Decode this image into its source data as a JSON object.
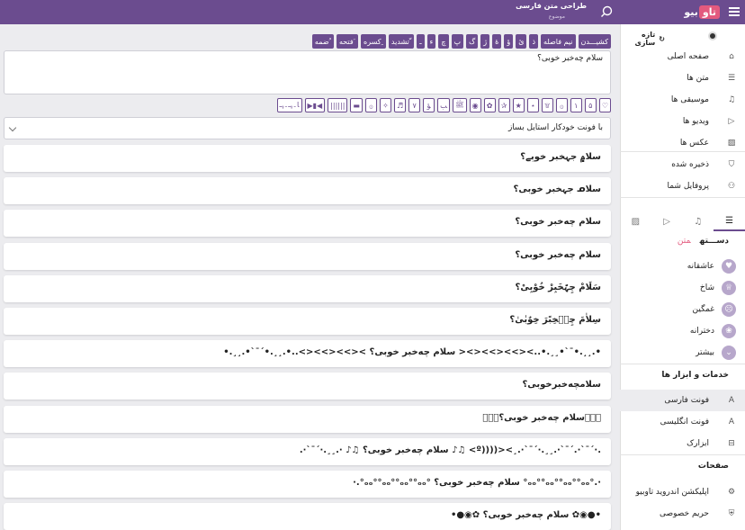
{
  "header": {
    "logo_word": "بیو",
    "logo_badge": "تاو",
    "title": "طراحی متن فارسی",
    "subtitle": "موضوع"
  },
  "keyboard": [
    "کشیـــدن",
    "نیم فاصله",
    "ذ",
    "ئ",
    "ؤ",
    "ۀ",
    "ژ",
    "ﮒ",
    "ﭖ",
    "ﭺ",
    "ء",
    "ـ",
    "تشدید ّ",
    "کسره ِ",
    "فتحه َ",
    "ضمه ُ"
  ],
  "input": {
    "value": "سلام چه‌خبر خوبی؟"
  },
  "symbols": [
    "♡",
    "۵",
    "۱",
    "۞",
    "۩",
    "⋆",
    "★",
    "✰",
    "✿",
    "◉",
    "ﷺ",
    "ﺐ",
    "ﺆ",
    "۷",
    "♬",
    "✧",
    "۞",
    "▬",
    "||||||",
    "▶▮◀",
    "ﺎ۔ﮩـ۔ﮩـ"
  ],
  "style_select": {
    "value": "با فونت خودکار استایل بساز"
  },
  "results": [
    "سلا۾ جہخبر خوٻے؟",
    "سلاᓄ جہخبر خوبی؟",
    "سلام چه‌خبر خوبی؟",
    "سلام چه‌خبر خوبی؟",
    "سَلَامْ چِہّخَبِرْ خُوْبِیْ؟",
    "سِلاٰمَ چِہؒخِبًرَ خِوٌبٰیٰ؟",
    "•.¸¸.•¯`•¸¸.•..><>><>><>< سلام چه‌خبر خوبی؟ ><>><>><>..•.¸¸.•´¯`•.¸¸.•",
    "سلامچه‌خبرخوبی؟",
    "⃟⃟⃟سلام چه‌خبر خوبی؟⃟⃟⃟",
    ".·´¯`·.´¯`·.¸¸.·´¯`·.¸><((((º> ♫♪ سلام چه‌خبر خوبی؟ ♫♪ ·.¸¸.·´¯`·.",
    "·.°ₒₒ°°ₒₒ°°ₒₒ°°ₒₒ° سلام چه‌خبر خوبی؟ °ₒₒ°°ₒₒ°°ₒₒ°°ₒₒ°.·",
    "•●◉✿ سلام چه‌خبر خوبی؟ ✿◉●•"
  ],
  "sidebar": {
    "refresh_label": "تازه سازی",
    "nav": [
      {
        "label": "صفحه اصلی",
        "icon": "home-icon",
        "glyph": "⌂"
      },
      {
        "label": "متن ها",
        "icon": "text-lines-icon",
        "glyph": "☰"
      },
      {
        "label": "موسیقی ها",
        "icon": "music-icon",
        "glyph": "♫"
      },
      {
        "label": "ویدیو ها",
        "icon": "play-icon",
        "glyph": "▷"
      },
      {
        "label": "عکس ها",
        "icon": "image-icon",
        "glyph": "▨"
      },
      {
        "label": "ذخیره شده",
        "icon": "bookmark-icon",
        "glyph": "⛉"
      },
      {
        "label": "پروفایل شما",
        "icon": "user-icon",
        "glyph": "⚇"
      }
    ],
    "category_heading": "دســـته",
    "category_current": "متن",
    "categories": [
      {
        "label": "عاشقانه",
        "icon": "heart-icon",
        "glyph": "♥"
      },
      {
        "label": "شاخ",
        "icon": "crown-icon",
        "glyph": "♕"
      },
      {
        "label": "غمگین",
        "icon": "sad-face-icon",
        "glyph": "☹"
      },
      {
        "label": "دخترانه",
        "icon": "flower-icon",
        "glyph": "❀"
      },
      {
        "label": "بیشتر",
        "icon": "chevron-down-icon",
        "glyph": "⌄"
      }
    ],
    "services_heading": "خدمات و ابزار ها",
    "services": [
      {
        "label": "فونت فارسی",
        "icon": "font-icon",
        "glyph": "A"
      },
      {
        "label": "فونت انگلیسی",
        "icon": "font-icon",
        "glyph": "A"
      },
      {
        "label": "ابزارک",
        "icon": "toolbox-icon",
        "glyph": "⊟"
      }
    ],
    "pages_heading": "صفحات",
    "pages": [
      {
        "label": "اپلیکشن اندروید تاوبیو",
        "icon": "android-icon",
        "glyph": "⚙"
      },
      {
        "label": "حریم خصوصی",
        "icon": "privacy-icon",
        "glyph": "⛨"
      }
    ]
  }
}
